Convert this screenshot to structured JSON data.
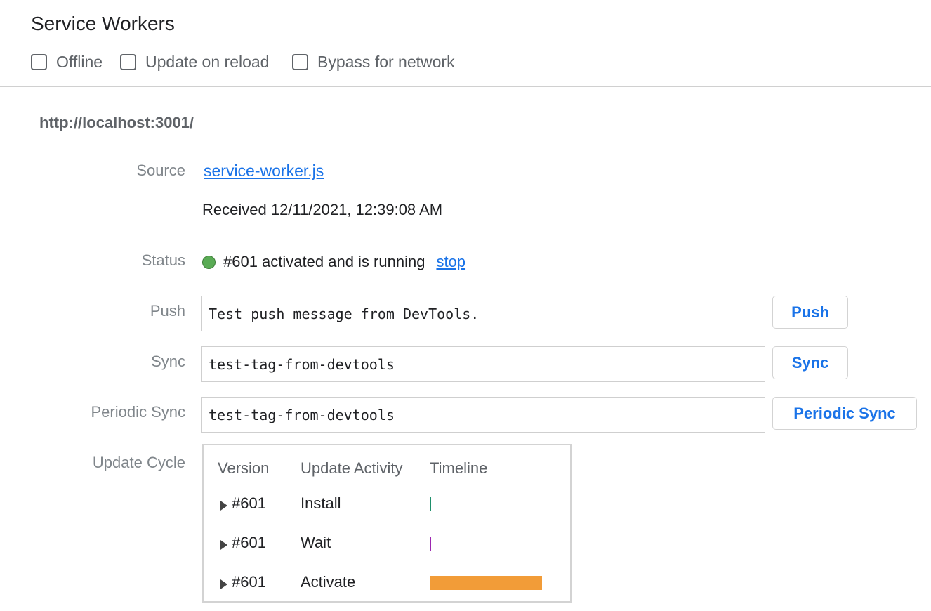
{
  "header": {
    "title": "Service Workers",
    "options": [
      {
        "label": "Offline",
        "checked": false
      },
      {
        "label": "Update on reload",
        "checked": false
      },
      {
        "label": "Bypass for network",
        "checked": false
      }
    ]
  },
  "worker": {
    "origin": "http://localhost:3001/",
    "source": {
      "label": "Source",
      "file": "service-worker.js",
      "received": "Received 12/11/2021, 12:39:08 AM"
    },
    "status": {
      "label": "Status",
      "text": "#601 activated and is running",
      "action": "stop",
      "color": "#5aab55"
    },
    "push": {
      "label": "Push",
      "value": "Test push message from DevTools.",
      "button": "Push"
    },
    "sync": {
      "label": "Sync",
      "value": "test-tag-from-devtools",
      "button": "Sync"
    },
    "periodic_sync": {
      "label": "Periodic Sync",
      "value": "test-tag-from-devtools",
      "button": "Periodic Sync"
    },
    "update_cycle": {
      "label": "Update Cycle",
      "columns": [
        "Version",
        "Update Activity",
        "Timeline"
      ],
      "rows": [
        {
          "version": "#601",
          "activity": "Install",
          "color": "#1e8f6b"
        },
        {
          "version": "#601",
          "activity": "Wait",
          "color": "#9c27b0"
        },
        {
          "version": "#601",
          "activity": "Activate",
          "color": "#f29c38"
        }
      ]
    }
  }
}
